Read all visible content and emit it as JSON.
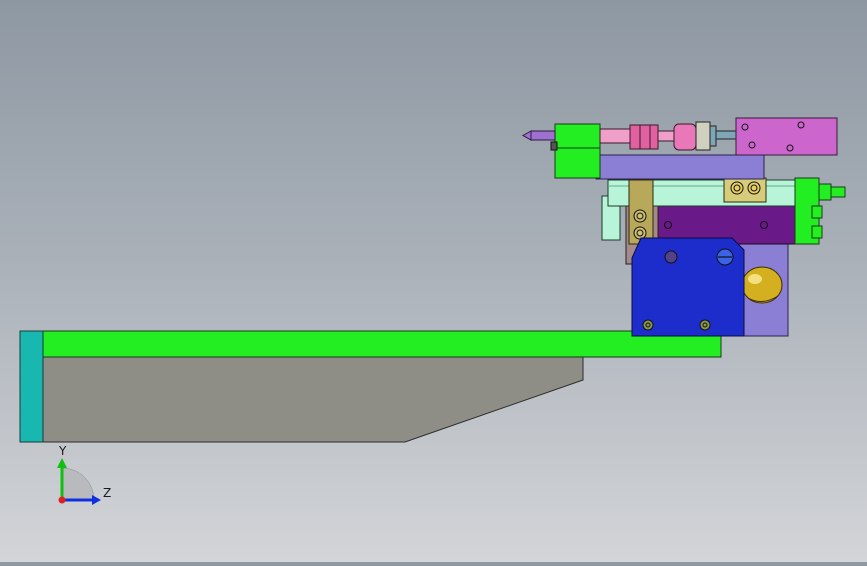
{
  "viewport": {
    "triad": {
      "y_label": "Y",
      "z_label": "Z",
      "icon": "coordinate-triad-icon"
    }
  },
  "colors": {
    "background_top": "#8e98a2",
    "background_bottom": "#d3d5d8",
    "green_part": "#22ee22",
    "teal_plate": "#18b8b0",
    "gray_part": "#8e8d86",
    "blue_block": "#1c2dcc",
    "purple_block": "#6a1a88",
    "lavender_plate": "#8a7fd4",
    "pink_block": "#cc66cc",
    "mint_rail": "#b8f5d8",
    "olive_clamp": "#b8a85a",
    "brass_ball": "#d4b020"
  }
}
